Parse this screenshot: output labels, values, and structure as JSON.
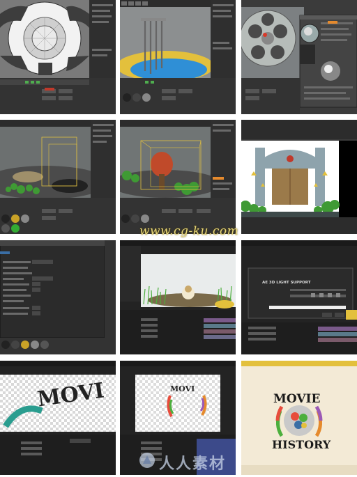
{
  "tiles": [
    {
      "id": "c4d-dome-topview",
      "app": "cinema4d"
    },
    {
      "id": "c4d-windchimes",
      "app": "cinema4d"
    },
    {
      "id": "c4d-film-reel-material",
      "app": "cinema4d"
    },
    {
      "id": "c4d-reel-plants-wide",
      "app": "cinema4d"
    },
    {
      "id": "c4d-reel-tree-selection",
      "app": "cinema4d"
    },
    {
      "id": "render-castle-gate",
      "app": "render"
    },
    {
      "id": "c4d-settings-dialog",
      "app": "cinema4d"
    },
    {
      "id": "ae-grass-comp",
      "app": "aftereffects"
    },
    {
      "id": "ae-3d-light-support-dialog",
      "app": "aftereffects",
      "dialog_title": "AE 3D LIGHT SUPPORT"
    },
    {
      "id": "ae-movie-text-closeup",
      "app": "aftereffects",
      "text": "MOVI"
    },
    {
      "id": "ae-movi-ring",
      "app": "aftereffects",
      "text": "MOVI"
    },
    {
      "id": "final-logo",
      "app": "render",
      "text_top": "MOVIE",
      "text_bottom": "HISTORY"
    }
  ],
  "watermarks": {
    "site": "www.cg-ku.com",
    "brand": "人人素材"
  },
  "colors": {
    "c4d_bg": "#3a3a3a",
    "c4d_panel": "#4a4a4a",
    "ae_bg": "#232323",
    "accent_orange": "#e58a2d",
    "grass": "#4caf3d"
  }
}
